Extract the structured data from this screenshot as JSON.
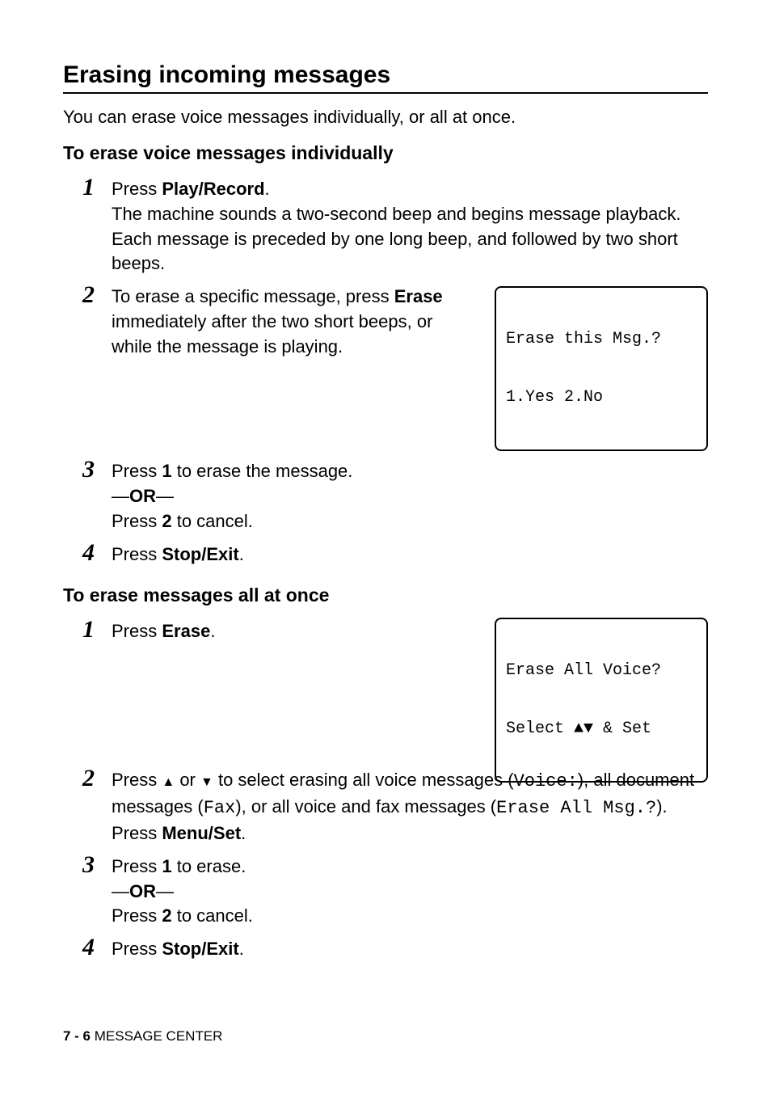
{
  "section_title": "Erasing incoming messages",
  "intro": "You can erase voice messages individually, or all at once.",
  "sub1_heading": "To erase voice messages individually",
  "sub1": {
    "step1": {
      "press_text": "Press ",
      "play_record": "Play/Record",
      "period": ".",
      "body": "The machine sounds a two-second beep and begins message playback. Each message is preceded by one long beep, and followed by two short beeps."
    },
    "step2": {
      "text_a": "To erase a specific message, press ",
      "erase": "Erase",
      "text_b": " immediately after the two short beeps, or while the message is playing.",
      "lcd_line1": "Erase this Msg.?",
      "lcd_line2": "1.Yes 2.No"
    },
    "step3": {
      "press_text": "Press ",
      "one": "1",
      "rest": " to erase the message.",
      "or": "—OR—",
      "press2_text": "Press ",
      "two": "2",
      "cancel": " to cancel."
    },
    "step4": {
      "press_text": "Press ",
      "stop_exit": "Stop/Exit",
      "period": "."
    }
  },
  "sub2_heading": "To erase messages all at once",
  "sub2": {
    "step1": {
      "press_text": "Press ",
      "erase": "Erase",
      "period": ".",
      "lcd_line1": "Erase All Voice?",
      "lcd_line2_a": "Select ",
      "lcd_line2_b": " & Set"
    },
    "step2": {
      "text_a": "Press ",
      "text_b": " or ",
      "text_c": " to select erasing all voice messages (",
      "voice": "Voice:",
      "text_d": "), all document messages (",
      "fax": "Fax",
      "text_e": "), or all voice and fax messages (",
      "erase_all": "Erase All Msg.?",
      "text_f": ").",
      "menuset_a": "Press ",
      "menuset_b": "Menu/Set",
      "menuset_c": "."
    },
    "step3": {
      "press_text": "Press ",
      "one": "1",
      "rest": " to erase.",
      "or": "—OR—",
      "press2_text": "Press ",
      "two": "2",
      "cancel": " to cancel."
    },
    "step4": {
      "press_text": "Press ",
      "stop_exit": "Stop/Exit",
      "period": "."
    }
  },
  "footer": {
    "page": "7 - 6",
    "section": "   MESSAGE CENTER"
  }
}
